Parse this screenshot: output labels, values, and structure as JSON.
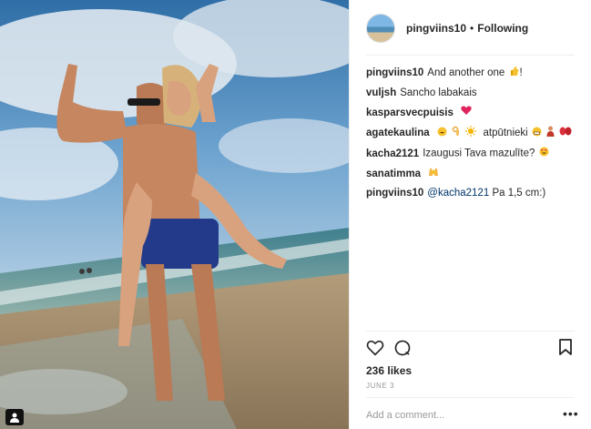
{
  "post": {
    "username": "pingviins10",
    "separator": "•",
    "follow_status": "Following",
    "likes": "236 likes",
    "date": "JUNE 3",
    "add_comment_placeholder": "Add a comment...",
    "more_label": "•••"
  },
  "comments": [
    {
      "user": "pingviins10",
      "text": "And another one",
      "emoji_after": [
        "thumbs-up"
      ],
      "trail": "!"
    },
    {
      "user": "vuljsh",
      "text": "Sancho labakais",
      "emoji_after": []
    },
    {
      "user": "kasparsvecpuisis",
      "text": "",
      "emoji_after": [
        "red-heart"
      ]
    },
    {
      "user": "agatekaulina",
      "text": "",
      "emoji_before": [
        "grinning-face",
        "ok-hand",
        "sun"
      ],
      "text2": "atpūtnieki",
      "emoji_after": [
        "grimace-face",
        "person",
        "flip-flops"
      ]
    },
    {
      "user": "kacha2121",
      "text": "Izaugusi Tava mazulīte?",
      "emoji_after": [
        "heart-eyes-face"
      ]
    },
    {
      "user": "sanatimma",
      "text": "",
      "emoji_after": [
        "raising-hands"
      ]
    },
    {
      "user": "pingviins10",
      "mention": "@kacha2121",
      "text": "Pa 1,5 cm:)",
      "emoji_after": []
    }
  ],
  "icons": {
    "like": "heart-outline-icon",
    "comment": "speech-bubble-icon",
    "save": "bookmark-icon",
    "user_tag": "person-tag-icon"
  },
  "colors": {
    "text": "#262626",
    "muted": "#999999",
    "mention": "#003569",
    "heart": "#ed4956",
    "divider": "#efefef"
  }
}
